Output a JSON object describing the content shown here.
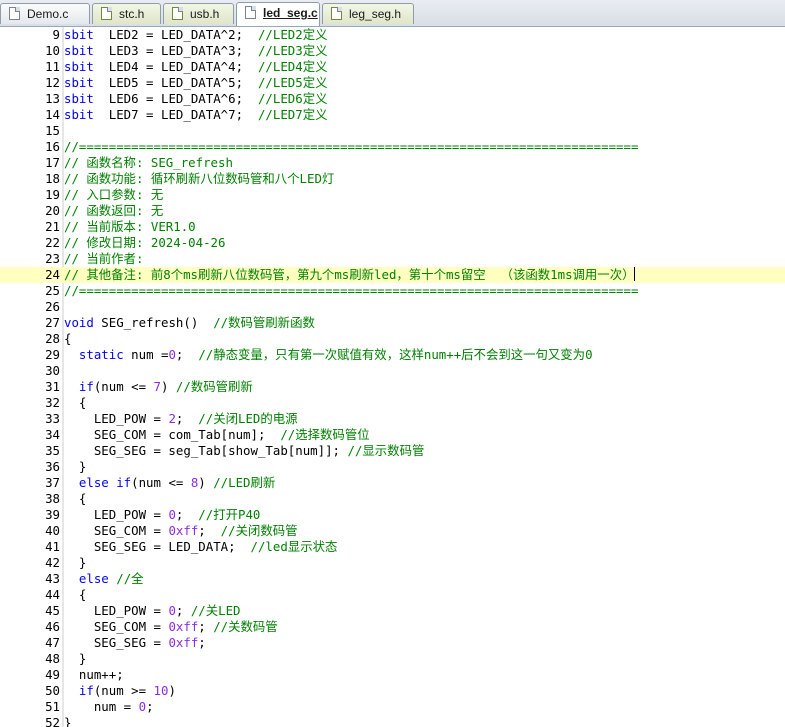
{
  "tabs": [
    {
      "label": "Demo.c",
      "kind": "c",
      "active": false
    },
    {
      "label": "stc.h",
      "kind": "h",
      "active": false
    },
    {
      "label": "usb.h",
      "kind": "h",
      "active": false
    },
    {
      "label": "led_seg.c",
      "kind": "c",
      "active": true
    },
    {
      "label": "leg_seg.h",
      "kind": "h",
      "active": false
    }
  ],
  "lines": [
    {
      "n": "9",
      "t": [
        [
          "kw",
          "sbit"
        ],
        [
          "",
          "  LED2 = LED_DATA^2;  "
        ],
        [
          "cm",
          "//LED2定义"
        ]
      ]
    },
    {
      "n": "10",
      "t": [
        [
          "kw",
          "sbit"
        ],
        [
          "",
          "  LED3 = LED_DATA^3;  "
        ],
        [
          "cm",
          "//LED3定义"
        ]
      ]
    },
    {
      "n": "11",
      "t": [
        [
          "kw",
          "sbit"
        ],
        [
          "",
          "  LED4 = LED_DATA^4;  "
        ],
        [
          "cm",
          "//LED4定义"
        ]
      ]
    },
    {
      "n": "12",
      "t": [
        [
          "kw",
          "sbit"
        ],
        [
          "",
          "  LED5 = LED_DATA^5;  "
        ],
        [
          "cm",
          "//LED5定义"
        ]
      ]
    },
    {
      "n": "13",
      "t": [
        [
          "kw",
          "sbit"
        ],
        [
          "",
          "  LED6 = LED_DATA^6;  "
        ],
        [
          "cm",
          "//LED6定义"
        ]
      ]
    },
    {
      "n": "14",
      "t": [
        [
          "kw",
          "sbit"
        ],
        [
          "",
          "  LED7 = LED_DATA^7;  "
        ],
        [
          "cm",
          "//LED7定义"
        ]
      ]
    },
    {
      "n": "15",
      "t": []
    },
    {
      "n": "16",
      "t": [
        [
          "cm",
          "//==========================================================================="
        ]
      ]
    },
    {
      "n": "17",
      "t": [
        [
          "cm",
          "// 函数名称: SEG_refresh"
        ]
      ]
    },
    {
      "n": "18",
      "t": [
        [
          "cm",
          "// 函数功能: 循环刷新八位数码管和八个LED灯"
        ]
      ]
    },
    {
      "n": "19",
      "t": [
        [
          "cm",
          "// 入口参数: 无"
        ]
      ]
    },
    {
      "n": "20",
      "t": [
        [
          "cm",
          "// 函数返回: 无"
        ]
      ]
    },
    {
      "n": "21",
      "t": [
        [
          "cm",
          "// 当前版本: VER1.0"
        ]
      ]
    },
    {
      "n": "22",
      "t": [
        [
          "cm",
          "// 修改日期: 2024-04-26"
        ]
      ]
    },
    {
      "n": "23",
      "t": [
        [
          "cm",
          "// 当前作者:"
        ]
      ]
    },
    {
      "n": "24",
      "cur": true,
      "t": [
        [
          "cm",
          "// 其他备注: 前8个ms刷新八位数码管，第九个ms刷新led，第十个ms留空  （该函数1ms调用一次）"
        ]
      ]
    },
    {
      "n": "25",
      "t": [
        [
          "cm",
          "//==========================================================================="
        ]
      ]
    },
    {
      "n": "26",
      "t": []
    },
    {
      "n": "27",
      "t": [
        [
          "kw",
          "void"
        ],
        [
          "",
          " SEG_refresh()  "
        ],
        [
          "cm",
          "//数码管刷新函数"
        ]
      ]
    },
    {
      "n": "28",
      "t": [
        [
          "",
          "{"
        ]
      ]
    },
    {
      "n": "29",
      "t": [
        [
          "",
          "  "
        ],
        [
          "kw",
          "static"
        ],
        [
          "",
          " num ="
        ],
        [
          "nm",
          "0"
        ],
        [
          "",
          ";  "
        ],
        [
          "cm",
          "//静态变量，只有第一次赋值有效，这样num++后不会到这一句又变为0"
        ]
      ]
    },
    {
      "n": "30",
      "t": []
    },
    {
      "n": "31",
      "t": [
        [
          "",
          "  "
        ],
        [
          "kw",
          "if"
        ],
        [
          "",
          "(num <= "
        ],
        [
          "nm",
          "7"
        ],
        [
          "",
          ") "
        ],
        [
          "cm",
          "//数码管刷新"
        ]
      ]
    },
    {
      "n": "32",
      "t": [
        [
          "",
          "  {"
        ]
      ]
    },
    {
      "n": "33",
      "t": [
        [
          "",
          "    LED_POW = "
        ],
        [
          "nm",
          "2"
        ],
        [
          "",
          ";  "
        ],
        [
          "cm",
          "//关闭LED的电源"
        ]
      ]
    },
    {
      "n": "34",
      "t": [
        [
          "",
          "    SEG_COM = com_Tab[num];  "
        ],
        [
          "cm",
          "//选择数码管位"
        ]
      ]
    },
    {
      "n": "35",
      "t": [
        [
          "",
          "    SEG_SEG = seg_Tab[show_Tab[num]]; "
        ],
        [
          "cm",
          "//显示数码管"
        ]
      ]
    },
    {
      "n": "36",
      "t": [
        [
          "",
          "  }"
        ]
      ]
    },
    {
      "n": "37",
      "t": [
        [
          "",
          "  "
        ],
        [
          "kw",
          "else if"
        ],
        [
          "",
          "(num <= "
        ],
        [
          "nm",
          "8"
        ],
        [
          "",
          ") "
        ],
        [
          "cm",
          "//LED刷新"
        ]
      ]
    },
    {
      "n": "38",
      "t": [
        [
          "",
          "  {"
        ]
      ]
    },
    {
      "n": "39",
      "t": [
        [
          "",
          "    LED_POW = "
        ],
        [
          "nm",
          "0"
        ],
        [
          "",
          ";  "
        ],
        [
          "cm",
          "//打开P40"
        ]
      ]
    },
    {
      "n": "40",
      "t": [
        [
          "",
          "    SEG_COM = "
        ],
        [
          "nm",
          "0xff"
        ],
        [
          "",
          ";  "
        ],
        [
          "cm",
          "//关闭数码管"
        ]
      ]
    },
    {
      "n": "41",
      "t": [
        [
          "",
          "    SEG_SEG = LED_DATA;  "
        ],
        [
          "cm",
          "//led显示状态"
        ]
      ]
    },
    {
      "n": "42",
      "t": [
        [
          "",
          "  }"
        ]
      ]
    },
    {
      "n": "43",
      "t": [
        [
          "",
          "  "
        ],
        [
          "kw",
          "else"
        ],
        [
          "",
          " "
        ],
        [
          "cm",
          "//全"
        ]
      ]
    },
    {
      "n": "44",
      "t": [
        [
          "",
          "  {"
        ]
      ]
    },
    {
      "n": "45",
      "t": [
        [
          "",
          "    LED_POW = "
        ],
        [
          "nm",
          "0"
        ],
        [
          "",
          "; "
        ],
        [
          "cm",
          "//关LED"
        ]
      ]
    },
    {
      "n": "46",
      "t": [
        [
          "",
          "    SEG_COM = "
        ],
        [
          "nm",
          "0xff"
        ],
        [
          "",
          "; "
        ],
        [
          "cm",
          "//关数码管"
        ]
      ]
    },
    {
      "n": "47",
      "t": [
        [
          "",
          "    SEG_SEG = "
        ],
        [
          "nm",
          "0xff"
        ],
        [
          "",
          ";"
        ]
      ]
    },
    {
      "n": "48",
      "t": [
        [
          "",
          "  }"
        ]
      ]
    },
    {
      "n": "49",
      "t": [
        [
          "",
          "  num++;"
        ]
      ]
    },
    {
      "n": "50",
      "t": [
        [
          "",
          "  "
        ],
        [
          "kw",
          "if"
        ],
        [
          "",
          "(num >= "
        ],
        [
          "nm",
          "10"
        ],
        [
          "",
          ")"
        ]
      ]
    },
    {
      "n": "51",
      "t": [
        [
          "",
          "    num = "
        ],
        [
          "nm",
          "0"
        ],
        [
          "",
          ";"
        ]
      ]
    },
    {
      "n": "52",
      "t": [
        [
          "",
          "}"
        ]
      ]
    }
  ],
  "colors": {
    "keyword": "#0000ff",
    "comment": "#008000",
    "number": "#8a2be2",
    "current_line": "#ffffbf"
  }
}
